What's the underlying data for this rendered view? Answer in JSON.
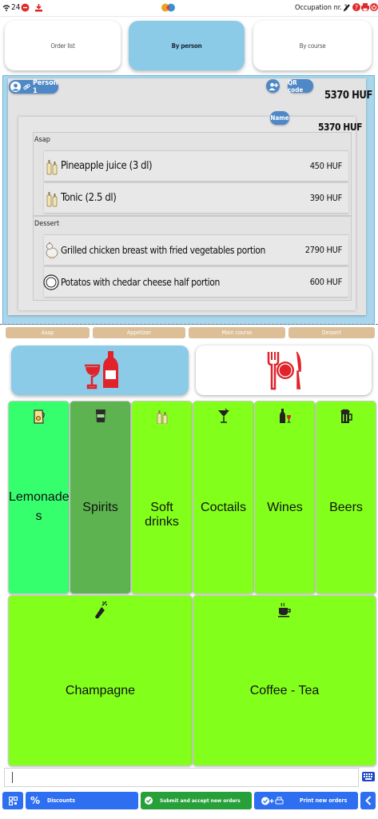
{
  "status": {
    "left_text": "24",
    "occupation": "Occupation nr. 1"
  },
  "tabs": [
    {
      "label": "Order list"
    },
    {
      "label": "By person"
    },
    {
      "label": "By course"
    }
  ],
  "person": {
    "label": "Person 1",
    "qr_label": "QR code",
    "total": "5370 HUF",
    "name_label": "Name",
    "subtotal": "5370 HUF"
  },
  "groups": [
    {
      "label": "Asap",
      "items": [
        {
          "name": "Pineapple juice (3 dl)",
          "price": "450 HUF",
          "icon": "drink-bottles-icon"
        },
        {
          "name": "Tonic (2.5 dl)",
          "price": "390 HUF",
          "icon": "drink-bottles-icon"
        }
      ]
    },
    {
      "label": "Dessert",
      "items": [
        {
          "name": "Grilled chicken breast with fried vegetables portion",
          "price": "2790 HUF",
          "icon": "chicken-icon"
        },
        {
          "name": "Potatos with chedar cheese half portion",
          "price": "600 HUF",
          "icon": "plate-icon"
        }
      ]
    }
  ],
  "courses": [
    "Asap",
    "Appetizer",
    "Main course",
    "Dessert"
  ],
  "categories": [
    {
      "label": "Lemonades",
      "line1": "Lemonade",
      "line2": "s",
      "icon": "lemonade-jug-icon",
      "color": "#36ff6e"
    },
    {
      "label": "Spirits",
      "icon": "spirits-glass-icon",
      "color": "#5cb34f"
    },
    {
      "label": "Soft drinks",
      "icon": "soft-drinks-icon",
      "color": "#82ff1a"
    },
    {
      "label": "Coctails",
      "icon": "cocktail-icon",
      "color": "#82ff1a"
    },
    {
      "label": "Wines",
      "icon": "wine-icon",
      "color": "#82ff1a"
    },
    {
      "label": "Beers",
      "icon": "beer-icon",
      "color": "#82ff1a"
    },
    {
      "label": "Champagne",
      "icon": "champagne-icon",
      "color": "#82ff1a"
    },
    {
      "label": "Coffee - Tea",
      "icon": "coffee-cup-icon",
      "color": "#82ff1a"
    }
  ],
  "bottom": {
    "discounts": "Discounts",
    "submit": "Submit and accept new orders",
    "print": "Print new orders"
  },
  "colors": {
    "accent_blue": "#8ccbe8",
    "button_blue": "#2d6ff0",
    "button_green": "#27a03a",
    "course_tan": "#dcbf97",
    "category_green": "#82ff1a"
  }
}
